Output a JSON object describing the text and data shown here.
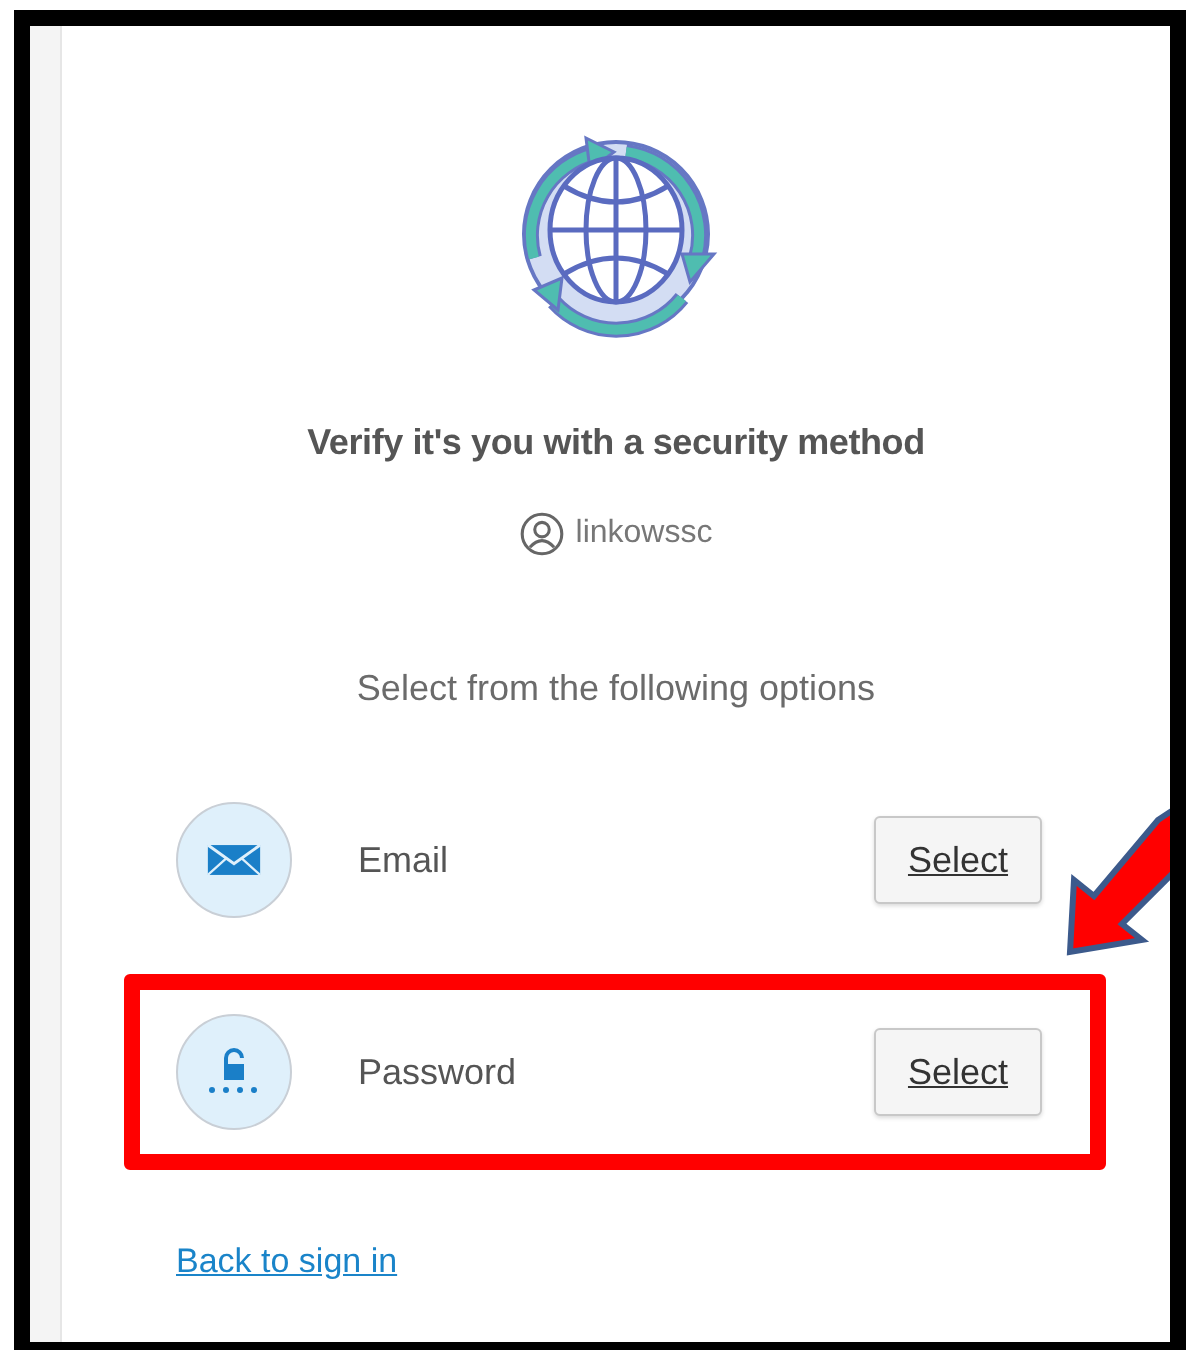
{
  "heading": "Verify it's you with a security method",
  "username": "linkowssc",
  "prompt": "Select from the following options",
  "options": [
    {
      "kind": "email",
      "label": "Email",
      "button": "Select",
      "highlighted": false
    },
    {
      "kind": "password",
      "label": "Password",
      "button": "Select",
      "highlighted": true
    }
  ],
  "back_link": "Back to sign in"
}
